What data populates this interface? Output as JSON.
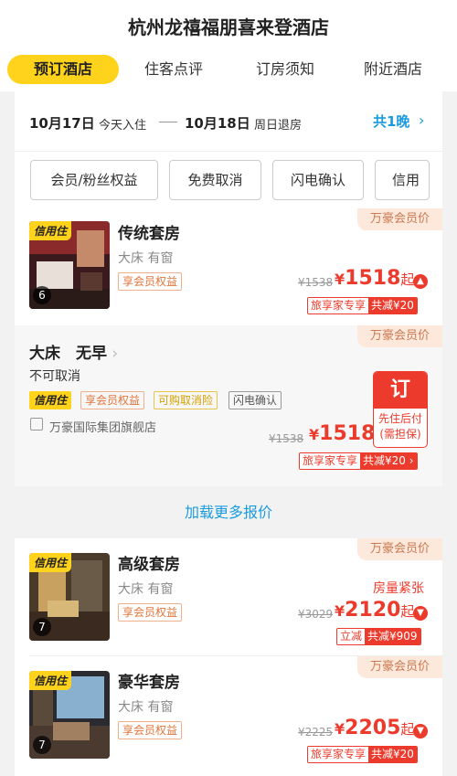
{
  "hotel_title": "杭州龙禧福朋喜来登酒店",
  "tabs": [
    {
      "label": "预订酒店",
      "active": true
    },
    {
      "label": "住客点评",
      "active": false
    },
    {
      "label": "订房须知",
      "active": false
    },
    {
      "label": "附近酒店",
      "active": false
    }
  ],
  "dates": {
    "checkin_date": "10月17日",
    "checkin_label": "今天入住",
    "checkout_date": "10月18日",
    "checkout_label": "周日退房",
    "nights": "共1晚",
    "chevron": "›"
  },
  "filters": [
    "会员/粉丝权益",
    "免费取消",
    "闪电确认",
    "信用"
  ],
  "member_badge": "万豪会员价",
  "credit_label": "信用住",
  "rooms": [
    {
      "name": "传统套房",
      "sub": "大床 有窗",
      "benefit": "享会员权益",
      "photo_count": "6",
      "old_price": "¥1538",
      "currency": "¥",
      "price": "1518",
      "suffix": "起",
      "status": "",
      "promo_a": "旅享家专享",
      "promo_b": "共减¥20"
    },
    {
      "name": "高级套房",
      "sub": "大床 有窗",
      "benefit": "享会员权益",
      "photo_count": "7",
      "old_price": "¥3029",
      "currency": "¥",
      "price": "2120",
      "suffix": "起",
      "status": "房量紧张",
      "promo_a": "立减",
      "promo_b": "共减¥909"
    },
    {
      "name": "豪华套房",
      "sub": "大床 有窗",
      "benefit": "享会员权益",
      "photo_count": "7",
      "old_price": "¥2225",
      "currency": "¥",
      "price": "2205",
      "suffix": "起",
      "status": "",
      "promo_a": "旅享家专享",
      "promo_b": "共减¥20"
    }
  ],
  "plan": {
    "title": "大床　无早",
    "cancel": "不可取消",
    "tags": [
      "信用住",
      "享会员权益",
      "可购取消险",
      "闪电确认"
    ],
    "shop": "万豪国际集团旗舰店",
    "old_price": "¥1538",
    "currency": "¥",
    "price": "1518",
    "book_label": "订",
    "book_sub1": "先住后付",
    "book_sub2": "(需担保)",
    "promo_a": "旅享家专享",
    "promo_b": "共减¥20 ›"
  },
  "load_more": "加载更多报价",
  "colors": {
    "accent_yellow": "#ffd21c",
    "price_red": "#ec3b2c",
    "link_blue": "#1a9be0",
    "member_bg": "#fde8dc"
  }
}
